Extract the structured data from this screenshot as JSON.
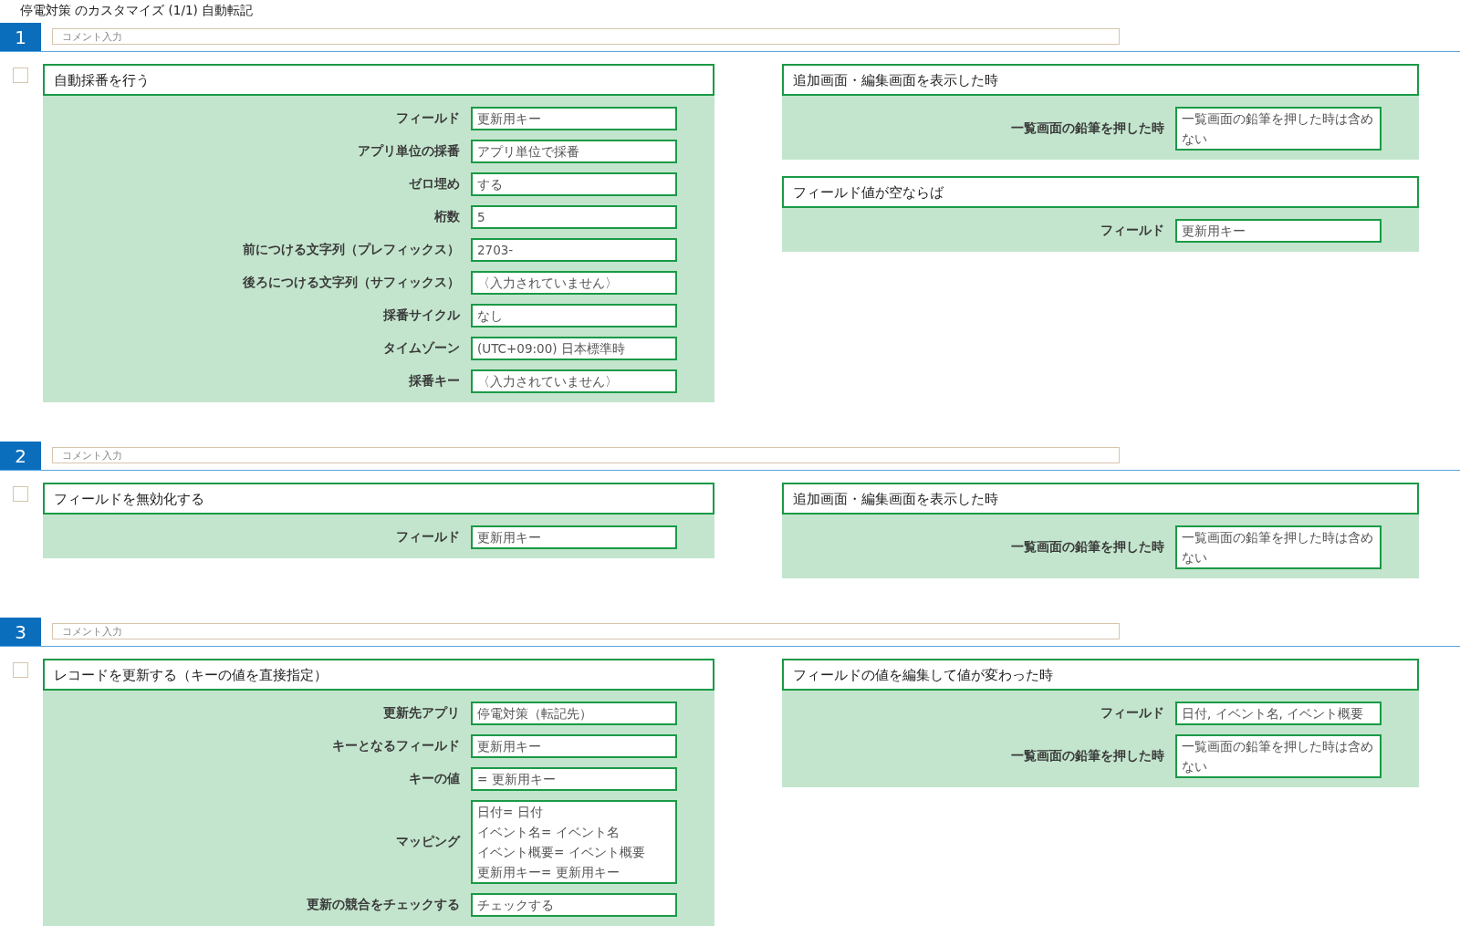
{
  "title": "停電対策 のカスタマイズ (1/1) 自動転記",
  "rules": [
    {
      "number": "1",
      "comment": {
        "placeholder": "コメント入力"
      },
      "checked": false,
      "action": {
        "title": "自動採番を行う",
        "fields": [
          {
            "label": "フィールド",
            "value": "更新用キー"
          },
          {
            "label": "アプリ単位の採番",
            "value": "アプリ単位で採番"
          },
          {
            "label": "ゼロ埋め",
            "value": "する"
          },
          {
            "label": "桁数",
            "value": "5"
          },
          {
            "label": "前につける文字列（プレフィックス）",
            "value": "2703-"
          },
          {
            "label": "後ろにつける文字列（サフィックス）",
            "value": "〈入力されていません〉"
          },
          {
            "label": "採番サイクル",
            "value": "なし"
          },
          {
            "label": "タイムゾーン",
            "value": "(UTC+09:00) 日本標準時"
          },
          {
            "label": "採番キー",
            "value": "〈入力されていません〉"
          }
        ]
      },
      "conditions": [
        {
          "title": "追加画面・編集画面を表示した時",
          "fields": [
            {
              "label": "一覧画面の鉛筆を押した時",
              "value": "一覧画面の鉛筆を押した時は含めない"
            }
          ]
        },
        {
          "title": "フィールド値が空ならば",
          "fields": [
            {
              "label": "フィールド",
              "value": "更新用キー"
            }
          ]
        }
      ]
    },
    {
      "number": "2",
      "comment": {
        "placeholder": "コメント入力"
      },
      "checked": false,
      "action": {
        "title": "フィールドを無効化する",
        "fields": [
          {
            "label": "フィールド",
            "value": "更新用キー"
          }
        ]
      },
      "conditions": [
        {
          "title": "追加画面・編集画面を表示した時",
          "fields": [
            {
              "label": "一覧画面の鉛筆を押した時",
              "value": "一覧画面の鉛筆を押した時は含めない"
            }
          ]
        }
      ]
    },
    {
      "number": "3",
      "comment": {
        "placeholder": "コメント入力"
      },
      "checked": false,
      "action": {
        "title": "レコードを更新する（キーの値を直接指定）",
        "fields": [
          {
            "label": "更新先アプリ",
            "value": "停電対策（転記先）"
          },
          {
            "label": "キーとなるフィールド",
            "value": "更新用キー"
          },
          {
            "label": "キーの値",
            "value": "= 更新用キー"
          },
          {
            "label": "マッピング",
            "lines": [
              "日付= 日付",
              "イベント名= イベント名",
              "イベント概要= イベント概要",
              "更新用キー= 更新用キー"
            ]
          },
          {
            "label": "更新の競合をチェックする",
            "value": "チェックする"
          }
        ]
      },
      "conditions": [
        {
          "title": "フィールドの値を編集して値が変わった時",
          "fields": [
            {
              "label": "フィールド",
              "value": "日付, イベント名, イベント概要"
            },
            {
              "label": "一覧画面の鉛筆を押した時",
              "value": "一覧画面の鉛筆を押した時は含めない"
            }
          ]
        }
      ]
    }
  ]
}
